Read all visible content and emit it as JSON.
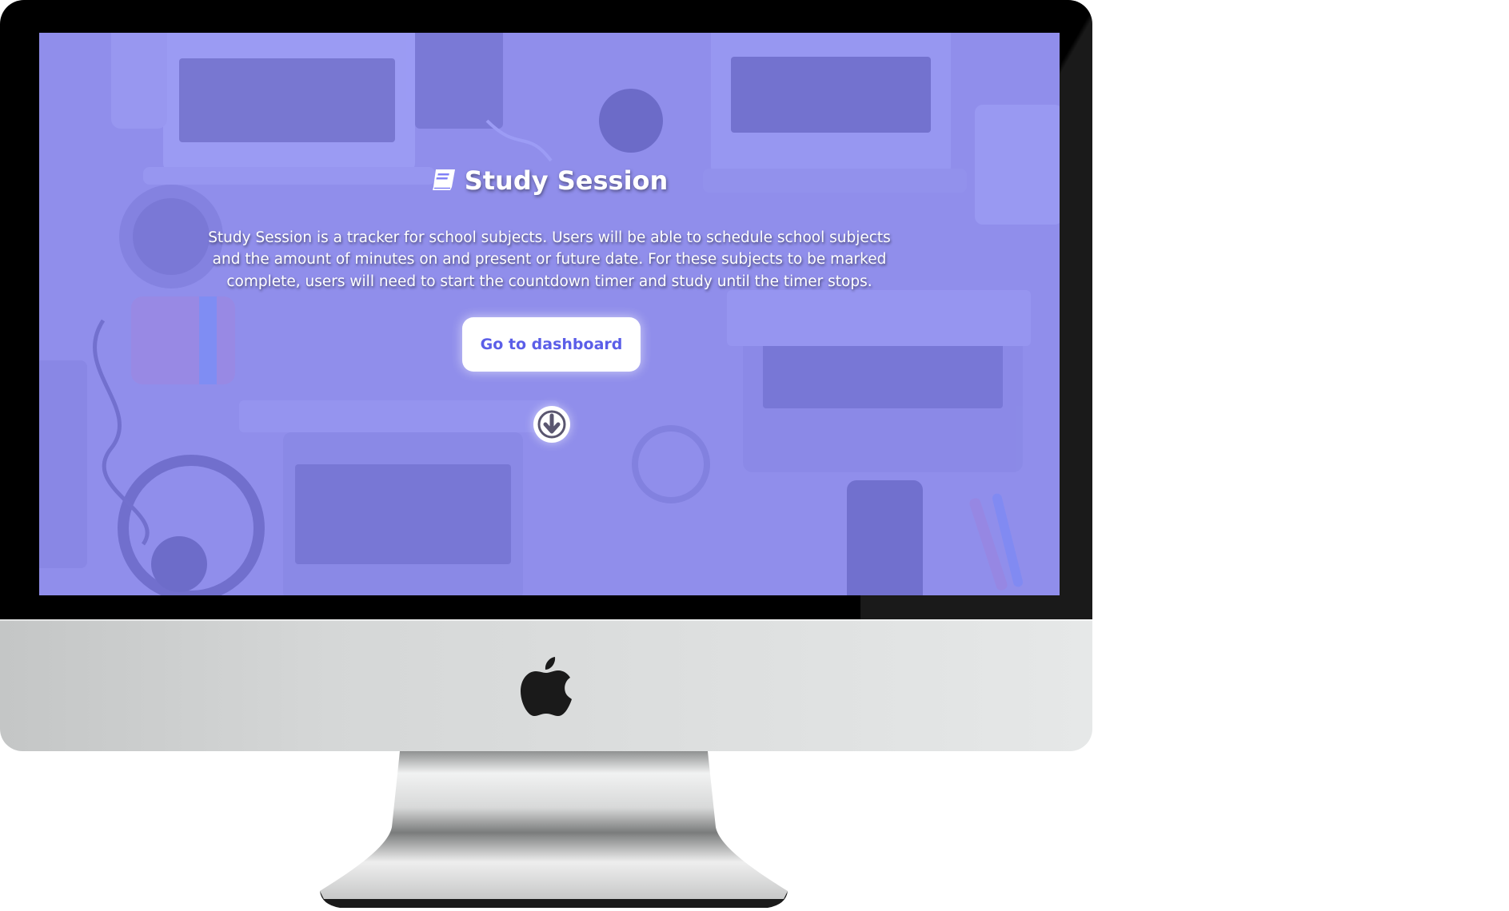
{
  "hero": {
    "title": "Study Session",
    "description": "Study Session is a tracker for school subjects. Users will be able to schedule school subjects and the amount of minutes on and present or future date. For these subjects to be marked complete, users will need to start the countdown timer and study until the timer stops.",
    "cta_label": "Go to dashboard",
    "title_icon": "book-icon",
    "scroll_icon": "arrow-circle-down-icon"
  },
  "colors": {
    "overlay": "#8080f6",
    "button_text": "#5b5ee8",
    "text": "#ffffff"
  }
}
